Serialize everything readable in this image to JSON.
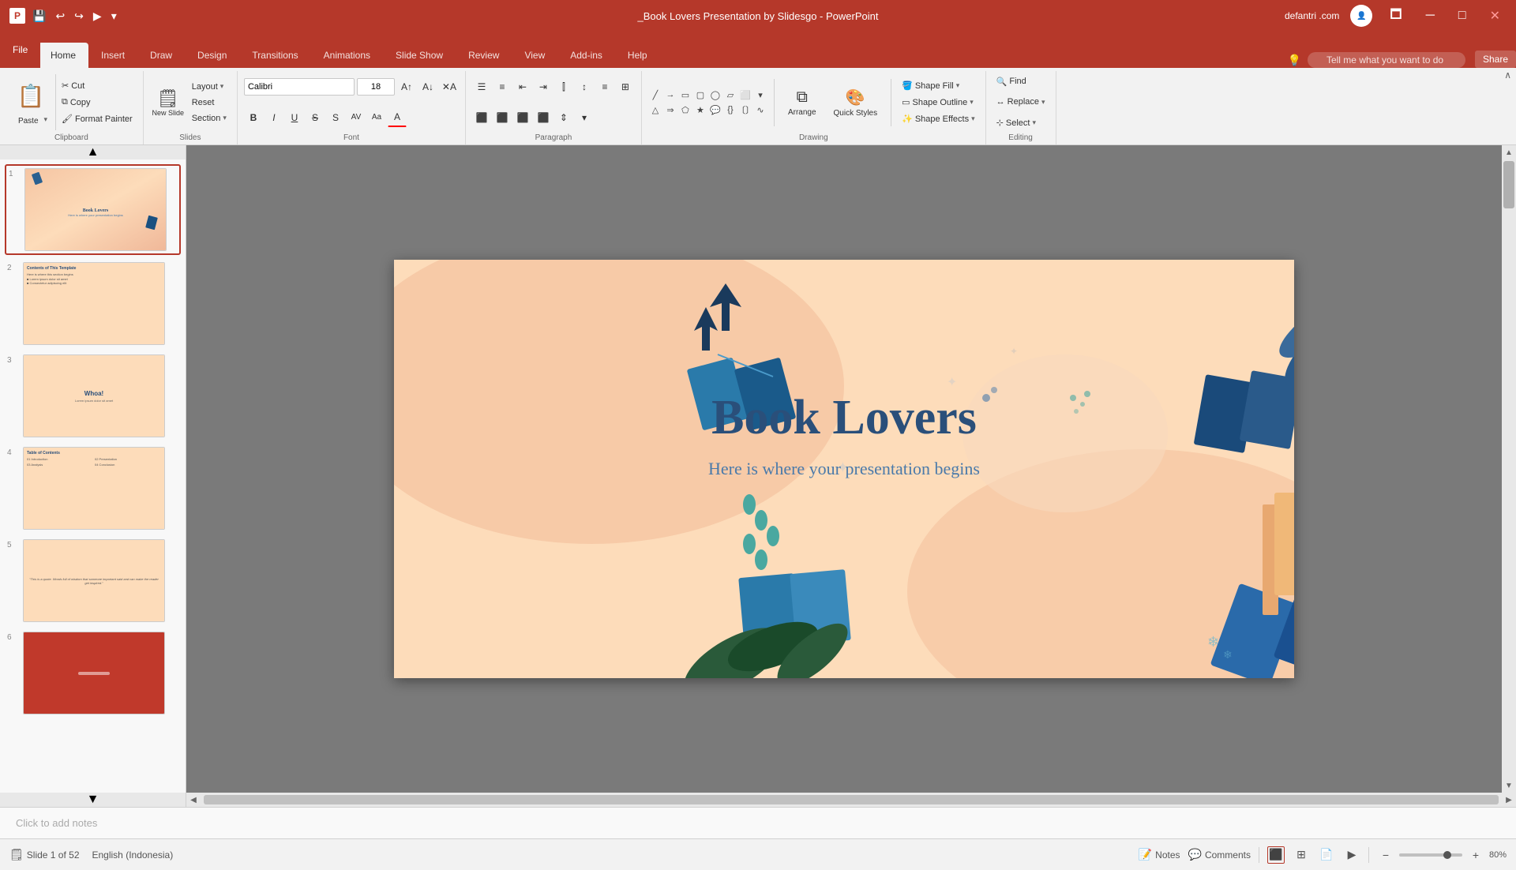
{
  "titlebar": {
    "title": "_Book Lovers Presentation by Slidesgo - PowerPoint",
    "user": "defantri .com",
    "qat": {
      "save": "💾",
      "undo": "↩",
      "redo": "↪",
      "present": "▶",
      "more": "▾"
    }
  },
  "tabs": [
    {
      "id": "file",
      "label": "File"
    },
    {
      "id": "home",
      "label": "Home",
      "active": true
    },
    {
      "id": "insert",
      "label": "Insert"
    },
    {
      "id": "draw",
      "label": "Draw"
    },
    {
      "id": "design",
      "label": "Design"
    },
    {
      "id": "transitions",
      "label": "Transitions"
    },
    {
      "id": "animations",
      "label": "Animations"
    },
    {
      "id": "slideshow",
      "label": "Slide Show"
    },
    {
      "id": "review",
      "label": "Review"
    },
    {
      "id": "view",
      "label": "View"
    },
    {
      "id": "addins",
      "label": "Add-ins"
    },
    {
      "id": "help",
      "label": "Help"
    }
  ],
  "tellme": {
    "placeholder": "Tell me what you want to do"
  },
  "share": "Share",
  "ribbon": {
    "clipboard": {
      "label": "Clipboard",
      "paste": "Paste",
      "cut": "Cut",
      "copy": "Copy",
      "formatPainter": "Format Painter"
    },
    "slides": {
      "label": "Slides",
      "newSlide": "New Slide",
      "layout": "Layout",
      "reset": "Reset",
      "section": "Section"
    },
    "font": {
      "label": "Font",
      "fontName": "Calibri",
      "fontSize": "18",
      "bold": "B",
      "italic": "I",
      "underline": "U",
      "strikethrough": "S",
      "shadow": "S",
      "charSpacing": "AV",
      "changeCase": "Aa",
      "fontColor": "A"
    },
    "paragraph": {
      "label": "Paragraph"
    },
    "drawing": {
      "label": "Drawing",
      "arrange": "Arrange",
      "quickStyles": "Quick Styles",
      "shapeFill": "Shape Fill",
      "shapeOutline": "Shape Outline",
      "shapeEffects": "Shape Effects"
    },
    "editing": {
      "label": "Editing",
      "find": "Find",
      "replace": "Replace",
      "select": "Select"
    }
  },
  "slide": {
    "title": "Book Lovers",
    "subtitle": "Here is where your presentation begins",
    "background": "#fddcba"
  },
  "slides": [
    {
      "num": 1,
      "active": true,
      "label": "Book Lovers"
    },
    {
      "num": 2,
      "label": "Contents"
    },
    {
      "num": 3,
      "label": "Whoa!"
    },
    {
      "num": 4,
      "label": "Table of Contents"
    },
    {
      "num": 5,
      "label": "Quote"
    },
    {
      "num": 6,
      "label": "Red slide"
    }
  ],
  "status": {
    "slideInfo": "Slide 1 of 52",
    "language": "English (Indonesia)",
    "notes": "Notes",
    "comments": "Comments",
    "zoom": "80%"
  },
  "notes": {
    "placeholder": "Click to add notes"
  }
}
